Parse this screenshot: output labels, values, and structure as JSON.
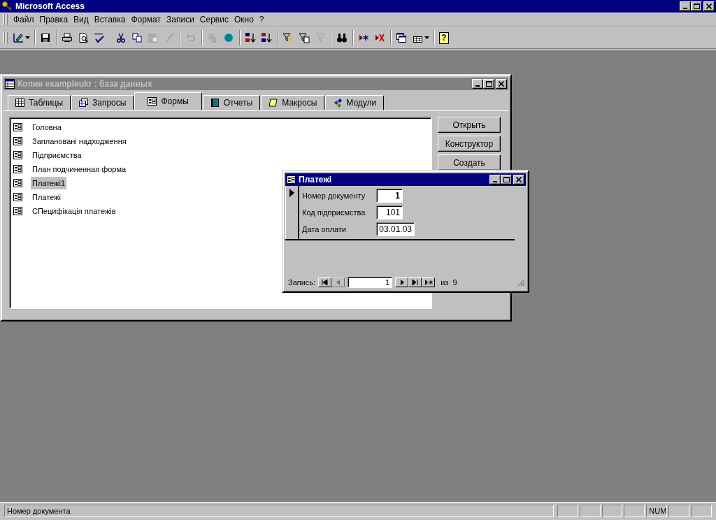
{
  "app": {
    "title": "Microsoft Access"
  },
  "menu": [
    {
      "label": "Файл"
    },
    {
      "label": "Правка"
    },
    {
      "label": "Вид"
    },
    {
      "label": "Вставка"
    },
    {
      "label": "Формат"
    },
    {
      "label": "Записи"
    },
    {
      "label": "Сервис"
    },
    {
      "label": "Окно"
    },
    {
      "label": "?"
    }
  ],
  "toolbar": [
    [
      {
        "disabled": false,
        "dropdown": true
      }
    ],
    [
      {
        "disabled": false
      }
    ],
    [
      {
        "disabled": false
      },
      {
        "disabled": false
      },
      {
        "disabled": false
      }
    ],
    [
      {
        "disabled": false
      },
      {
        "disabled": false
      },
      {
        "disabled": true
      },
      {
        "disabled": true
      }
    ],
    [
      {
        "disabled": true
      }
    ],
    [
      {
        "disabled": true
      },
      {
        "disabled": false
      }
    ],
    [
      {
        "disabled": false
      },
      {
        "disabled": false
      }
    ],
    [
      {
        "disabled": false
      },
      {
        "disabled": false
      },
      {
        "disabled": true
      }
    ],
    [
      {
        "disabled": false
      }
    ],
    [
      {
        "disabled": false
      },
      {
        "disabled": false
      }
    ],
    [
      {
        "disabled": false
      },
      {
        "disabled": false,
        "dropdown": true
      }
    ],
    [
      {
        "disabled": false,
        "glyph": "?"
      }
    ]
  ],
  "db_window": {
    "title": "Копия exampleukr : база данных",
    "active": false,
    "tabs": [
      {
        "label": "Таблицы",
        "selected": false
      },
      {
        "label": "Запросы",
        "selected": false
      },
      {
        "label": "Формы",
        "selected": true
      },
      {
        "label": "Отчеты",
        "selected": false
      },
      {
        "label": "Макросы",
        "selected": false
      },
      {
        "label": "Модули",
        "selected": false
      }
    ],
    "items": [
      {
        "label": "Головна",
        "selected": false
      },
      {
        "label": "Заплановані надходження",
        "selected": false
      },
      {
        "label": "Підприємства",
        "selected": false
      },
      {
        "label": "План подчиненная форма",
        "selected": false
      },
      {
        "label": "Платежі1",
        "selected": true
      },
      {
        "label": "Платежі",
        "selected": false
      },
      {
        "label": "СПецифікація платежів",
        "selected": false
      }
    ],
    "buttons": [
      {
        "label": "Открыть"
      },
      {
        "label": "Конструктор"
      },
      {
        "label": "Создать"
      }
    ]
  },
  "form_window": {
    "title": "Платежі",
    "active": true,
    "fields": [
      {
        "label": "Номер документу",
        "value": "1",
        "focused": true
      },
      {
        "label": "Код підприємства",
        "value": "101",
        "focused": false
      },
      {
        "label": "Дата оплати",
        "value": "03.01.03",
        "focused": false
      }
    ],
    "navigator": {
      "label": "Запись:",
      "current": "1",
      "total": "из  9",
      "prev_disabled": true,
      "first_disabled": false
    }
  },
  "status_bar": {
    "text": "Номер документа",
    "indicators": [
      {
        "kind": "empty"
      },
      {
        "kind": "empty"
      },
      {
        "kind": "empty"
      },
      {
        "kind": "empty"
      },
      {
        "kind": "text",
        "text": "NUM"
      },
      {
        "kind": "empty"
      },
      {
        "kind": "empty"
      }
    ]
  }
}
